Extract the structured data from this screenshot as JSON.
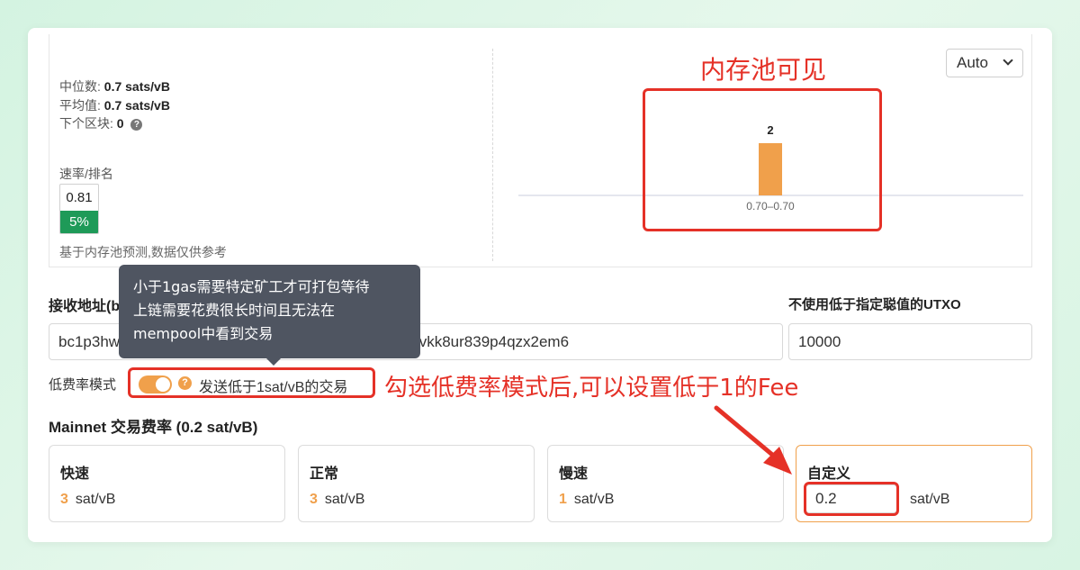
{
  "stats": {
    "median_label": "中位数:",
    "median_value": "0.7 sats/vB",
    "average_label": "平均值:",
    "average_value": "0.7 sats/vB",
    "next_block_label": "下个区块:",
    "next_block_value": "0",
    "help_glyph": "?"
  },
  "rate": {
    "label": "速率/排名",
    "value": "0.81",
    "rank": "5%",
    "note": "基于内存池预测,数据仅供参考"
  },
  "auto_select": {
    "value": "Auto"
  },
  "chart_data": {
    "type": "bar",
    "categories": [
      "0.70–0.70"
    ],
    "values": [
      2
    ],
    "data_labels": [
      "2"
    ],
    "color": "#f0a04b"
  },
  "annotations": {
    "mempool_visible": "内存池可见",
    "lowfee_hint": "勾选低费率模式后,可以设置低于1的Fee",
    "color": "#e53127"
  },
  "receive": {
    "label": "接收地址(bc1p或bc1q)",
    "address": "bc1p3hw2pqpz5gd8m4kl9dhvyygene6urfl20yu89yxr2vkk8ur839p4qzx2em6"
  },
  "utxo": {
    "label": "不使用低于指定聪值的UTXO",
    "value": "10000"
  },
  "lowfee": {
    "label": "低费率模式",
    "text": "发送低于1sat/vB的交易",
    "help_glyph": "?",
    "enabled": true
  },
  "tooltip": {
    "line1": "小于1gas需要特定矿工才可打包等待",
    "line2": "上链需要花费很长时间且无法在",
    "line3": "mempool中看到交易"
  },
  "fee": {
    "title": "Mainnet 交易费率 (0.2 sat/vB)",
    "options": [
      {
        "name": "快速",
        "value": "3",
        "unit": "sat/vB"
      },
      {
        "name": "正常",
        "value": "3",
        "unit": "sat/vB"
      },
      {
        "name": "慢速",
        "value": "1",
        "unit": "sat/vB"
      }
    ],
    "custom": {
      "name": "自定义",
      "value": "0.2",
      "unit": "sat/vB"
    }
  }
}
